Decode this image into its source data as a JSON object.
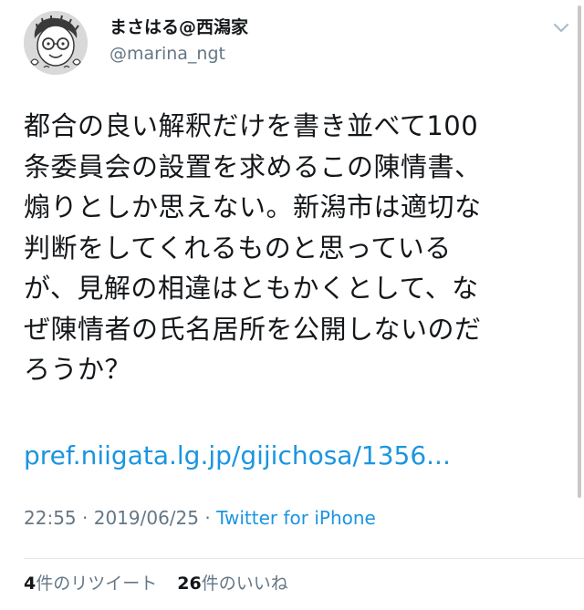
{
  "author": {
    "display_name": "まさはる@西潟家",
    "handle": "@marina_ngt",
    "avatar_icon": "sketch-face-avatar"
  },
  "tweet": {
    "text": "都合の良い解釈だけを書き並べて100\n条委員会の設置を求めるこの陳情書、\n煽りとしか思えない。新潟市は適切な\n判断をしてくれるものと思っている\nが、見解の相違はともかくとして、な\nぜ陳情者の氏名居所を公開しないのだ\nろうか？",
    "link": "pref.niigata.lg.jp/gijichosa/1356...",
    "time": "22:55",
    "separator1": " · ",
    "date": "2019/06/25",
    "separator2": " · ",
    "source": "Twitter for iPhone"
  },
  "stats": {
    "retweets_count": "4",
    "retweets_label": "件のリツイート",
    "likes_count": "26",
    "likes_label": "件のいいね"
  },
  "colors": {
    "link": "#1b95e0",
    "secondary_text": "#657786",
    "primary_text": "#14171a"
  }
}
